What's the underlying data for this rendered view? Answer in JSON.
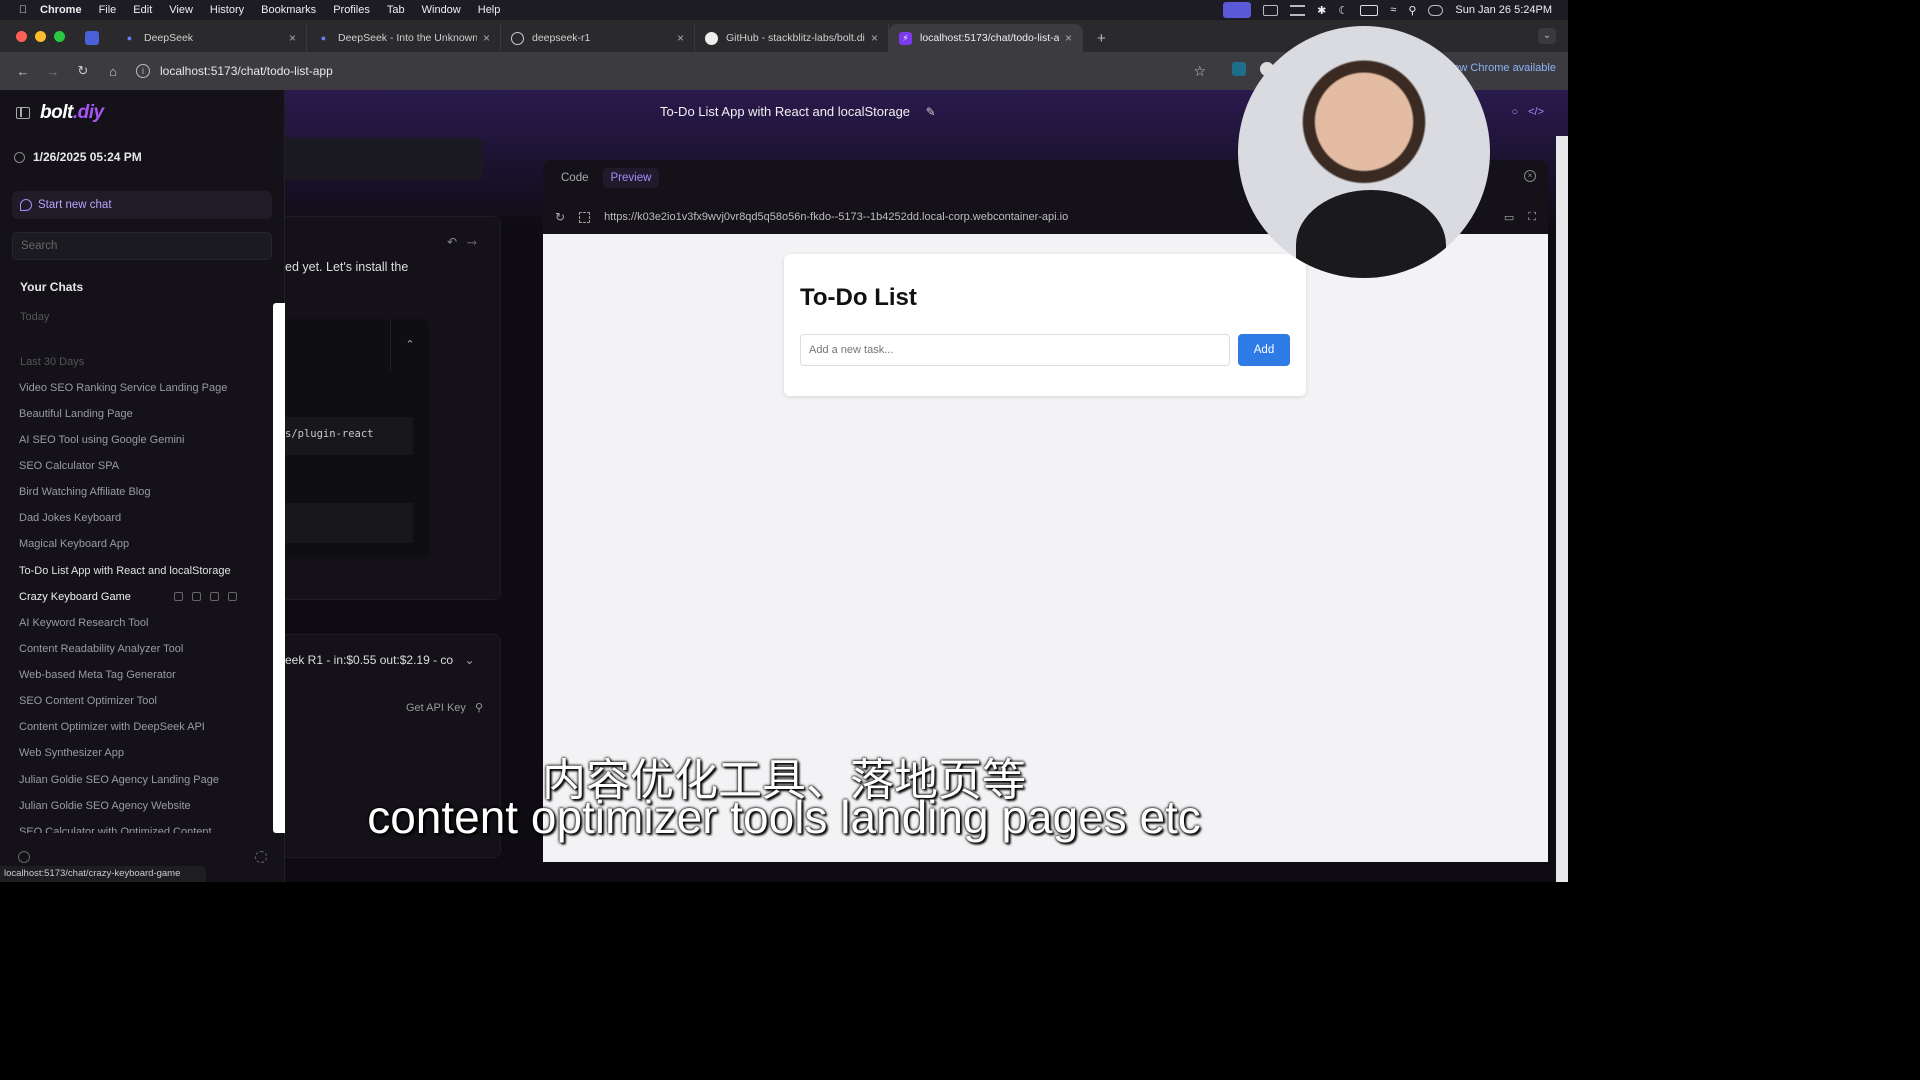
{
  "menubar": {
    "app": "Chrome",
    "items": [
      "File",
      "Edit",
      "View",
      "History",
      "Bookmarks",
      "Profiles",
      "Tab",
      "Window",
      "Help"
    ],
    "clock": "Sun Jan 26  5:24PM"
  },
  "tabs": [
    {
      "label": "DeepSeek"
    },
    {
      "label": "DeepSeek - Into the Unknown"
    },
    {
      "label": "deepseek-r1"
    },
    {
      "label": "GitHub - stackblitz-labs/bolt.diy"
    },
    {
      "label": "localhost:5173/chat/todo-list-app"
    }
  ],
  "omnibox": {
    "url": "localhost:5173/chat/todo-list-app"
  },
  "toolbar": {
    "new_chrome": "New Chrome available"
  },
  "header": {
    "title": "To-Do List App with React and localStorage"
  },
  "sidebar": {
    "logo_main": "bolt",
    "logo_accent": ".diy",
    "datetime": "1/26/2025 05:24 PM",
    "new_chat": "Start new chat",
    "search_placeholder": "Search",
    "your_chats": "Your Chats",
    "group_today": "Today",
    "group_last30": "Last 30 Days",
    "chats": [
      "Video SEO Ranking Service Landing Page",
      "Beautiful Landing Page",
      "AI SEO Tool using Google Gemini",
      "SEO Calculator SPA",
      "Bird Watching Affiliate Blog",
      "Dad Jokes Keyboard",
      "Magical Keyboard App",
      "To-Do List App with React and localStorage",
      "Crazy Keyboard Game",
      "AI Keyword Research Tool",
      "Content Readability Analyzer Tool",
      "Web-based Meta Tag Generator",
      "SEO Content Optimizer Tool",
      "Content Optimizer with DeepSeek API",
      "Web Synthesizer App",
      "Julian Goldie SEO Agency Landing Page",
      "Julian Goldie SEO Agency Website",
      "SEO Calculator with Optimized Content"
    ]
  },
  "chatpanel": {
    "message": "ed yet. Let's install the",
    "code": "s/plugin-react",
    "model": "eek R1 - in:$0.55 out:$2.19 - co",
    "get_api_key": "Get API Key"
  },
  "workbench": {
    "tab_code": "Code",
    "tab_preview": "Preview",
    "url": "https://k03e2io1v3fx9wvj0vr8qd5q58o56n-fkdo--5173--1b4252dd.local-corp.webcontainer-api.io"
  },
  "todo": {
    "title": "To-Do List",
    "placeholder": "Add a new task...",
    "add": "Add"
  },
  "statusbar": {
    "url": "localhost:5173/chat/crazy-keyboard-game"
  },
  "subtitles": {
    "zh": "内容优化工具、落地页等",
    "en": "content optimizer tools landing pages etc"
  }
}
